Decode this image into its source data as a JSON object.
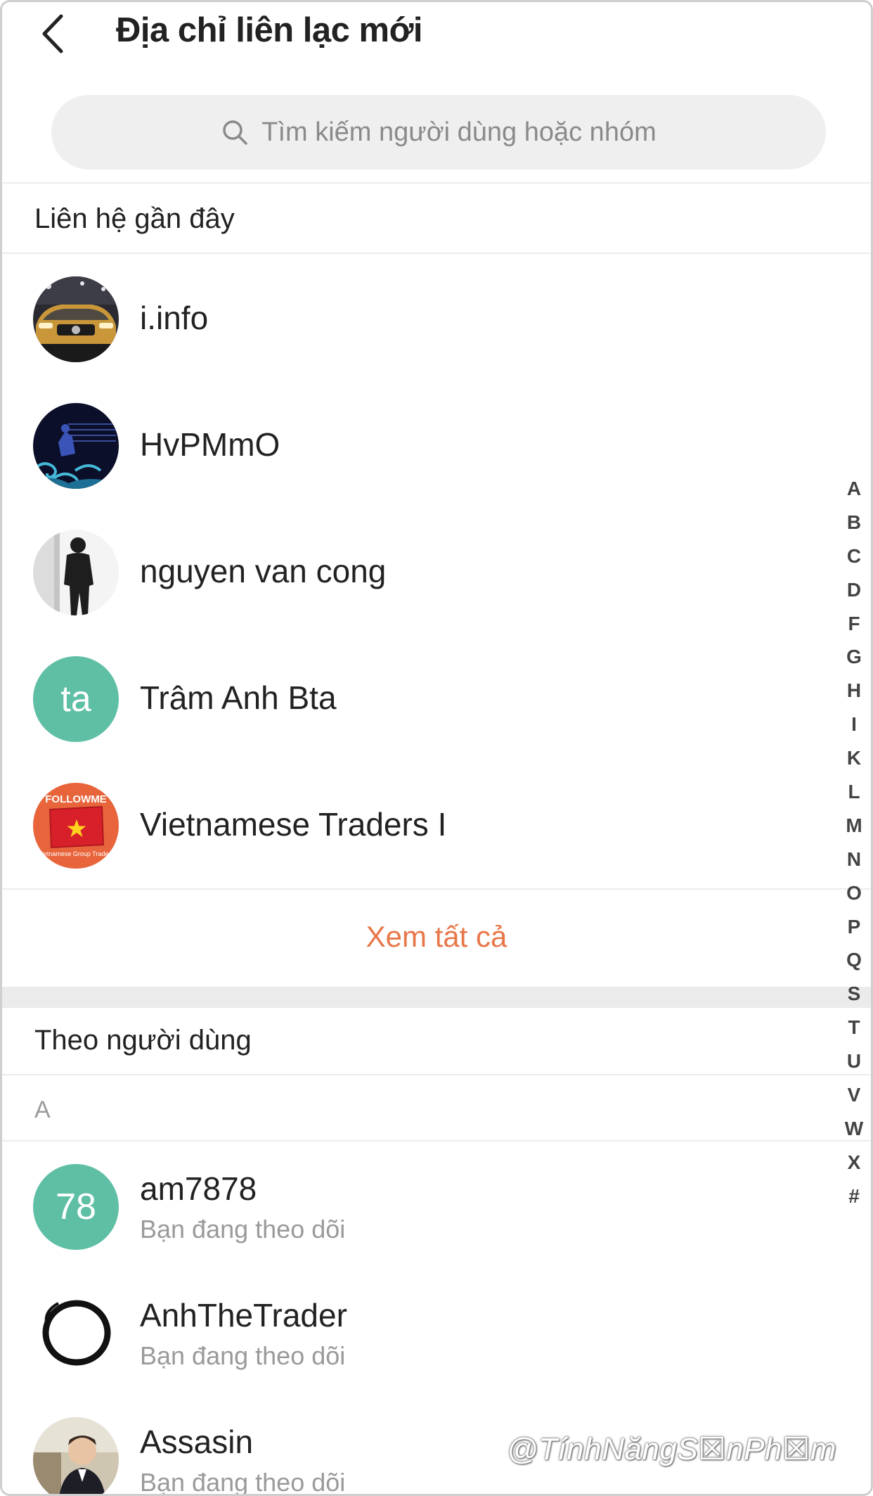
{
  "header": {
    "title": "Địa chỉ liên lạc mới",
    "back_icon": "chevron-left-icon"
  },
  "search": {
    "placeholder": "Tìm kiếm người dùng hoặc nhóm",
    "icon": "search-icon"
  },
  "recent": {
    "title": "Liên hệ gần đây",
    "items": [
      {
        "name": "i.info",
        "avatar": "car-photo-avatar"
      },
      {
        "name": "HvPMmO",
        "avatar": "night-wave-avatar"
      },
      {
        "name": "nguyen van cong",
        "avatar": "silhouette-photo-avatar"
      },
      {
        "name": "Trâm Anh Bta",
        "avatar_text": "ta",
        "avatar_color": "#5fbfa5"
      },
      {
        "name": "Vietnamese Traders I",
        "avatar": "followme-flag-avatar",
        "avatar_label": "FOLLOWME",
        "avatar_caption": "Vietnamese Group Traders"
      }
    ],
    "see_all": "Xem tất cả"
  },
  "following": {
    "title": "Theo người dùng",
    "letter": "A",
    "items": [
      {
        "name": "am7878",
        "status": "Bạn đang theo dõi",
        "avatar_text": "78",
        "avatar_color": "#5fbfa5"
      },
      {
        "name": "AnhTheTrader",
        "status": "Bạn đang theo dõi",
        "avatar": "ink-circle-avatar"
      },
      {
        "name": "Assasin",
        "status": "Bạn đang theo dõi",
        "avatar": "portrait-photo-avatar"
      }
    ]
  },
  "index": [
    "A",
    "B",
    "C",
    "D",
    "F",
    "G",
    "H",
    "I",
    "K",
    "L",
    "M",
    "N",
    "O",
    "P",
    "Q",
    "S",
    "T",
    "U",
    "V",
    "W",
    "X",
    "#"
  ],
  "watermark": "@TínhNăngS☒nPh☒m",
  "colors": {
    "accent": "#e8774a",
    "teal": "#5fbfa5",
    "separator": "#ececec"
  }
}
